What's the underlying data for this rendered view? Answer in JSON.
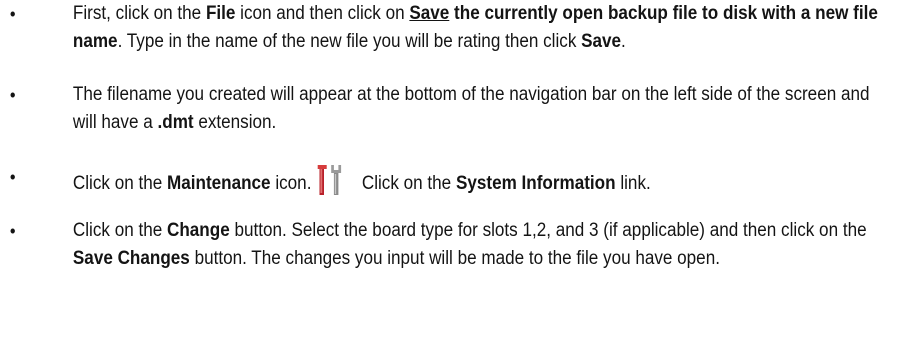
{
  "steps": [
    {
      "a": "First, click on the ",
      "b1": "File",
      "c": " icon and then click on ",
      "b2_u": "Save",
      "b3": " the currently open backup file to disk with a new file name",
      "d": ". Type in the name of the new file you will be rating then click ",
      "b4": "Save",
      "e": "."
    },
    {
      "a": "The filename you created will appear at the bottom of the navigation bar on the left side of the screen and will have a ",
      "b1": ".dmt",
      "c": " extension."
    },
    {
      "a": "Click on the ",
      "b1": "Maintenance",
      "c": " icon.",
      "icon": "maintenance-tools-icon",
      "d": "Click on the ",
      "b2": "System Information",
      "e": " link."
    },
    {
      "a": "Click on the ",
      "b1": "Change",
      "c": " button. Select the board type for slots 1,2, and 3 (if applicable) and then click on the ",
      "b2": "Save Changes",
      "d": " button. The changes you input will be made to the file you have open."
    }
  ],
  "bullet": "•",
  "colors": {
    "text": "#141414",
    "icon_red": "#b8202a",
    "icon_gray": "#8a8a8a"
  }
}
